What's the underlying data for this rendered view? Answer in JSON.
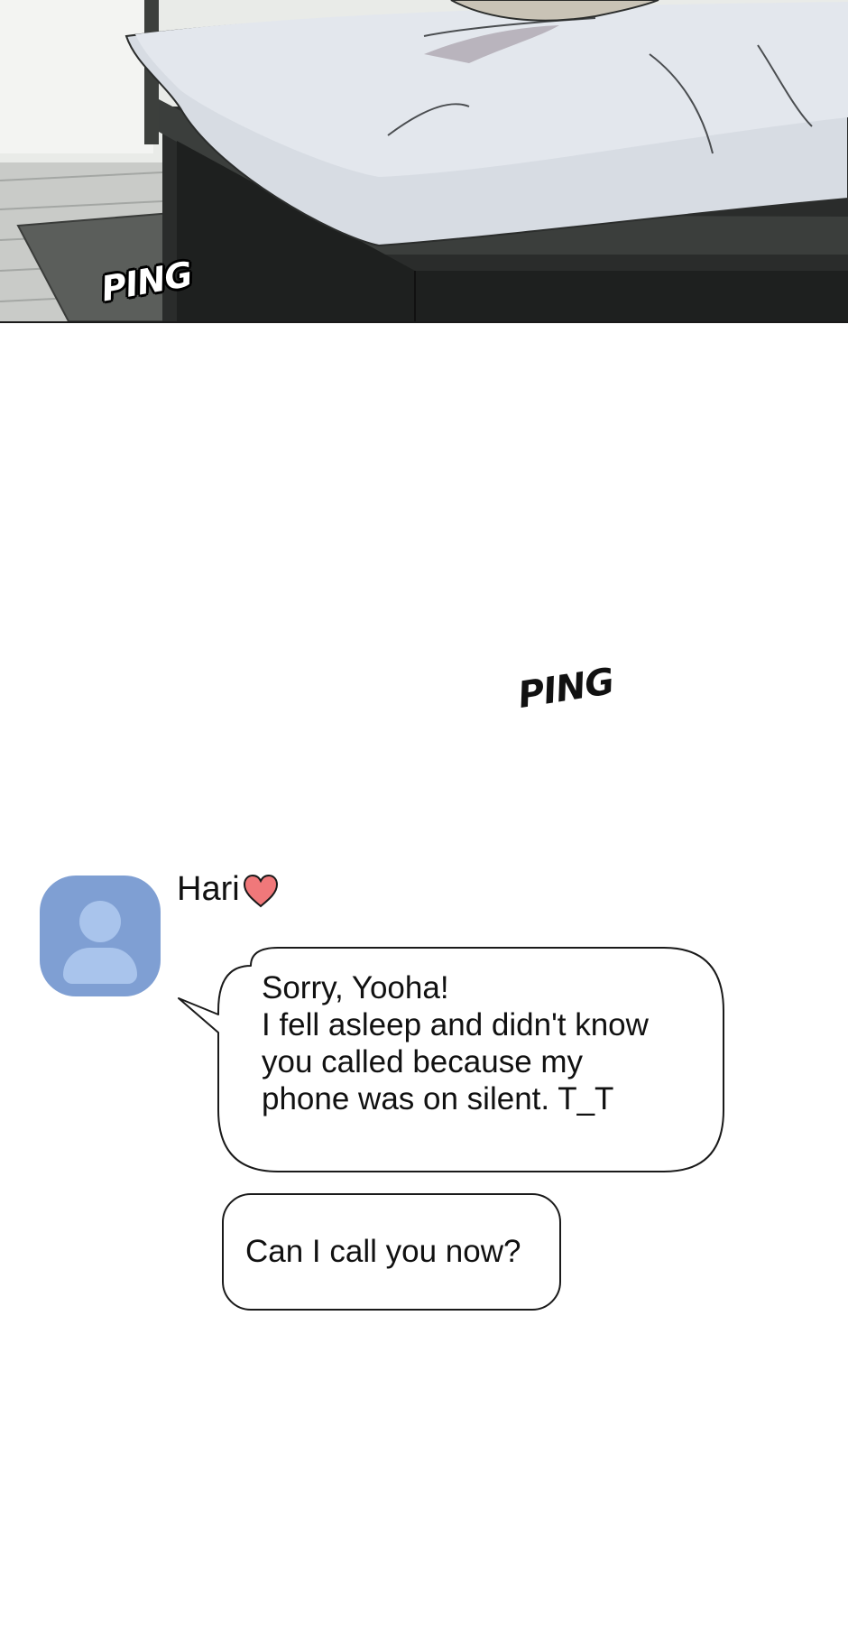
{
  "panel_top": {
    "sound_effect": "PING"
  },
  "panel_middle": {
    "sound_effect": "PING"
  },
  "chat": {
    "sender": {
      "name": "Hari",
      "icon": "heart-icon",
      "avatar_icon": "default-user-avatar-icon"
    },
    "messages": [
      {
        "lines": [
          "Sorry, Yooha!",
          "I fell asleep and didn't know",
          "you called because my",
          "phone was on silent. T_T"
        ]
      },
      {
        "lines": [
          "Can I call you now?"
        ]
      }
    ],
    "colors": {
      "avatar_bg": "#7f9fd3",
      "avatar_figure": "#a9c4ec",
      "heart": "#f0787a"
    }
  }
}
